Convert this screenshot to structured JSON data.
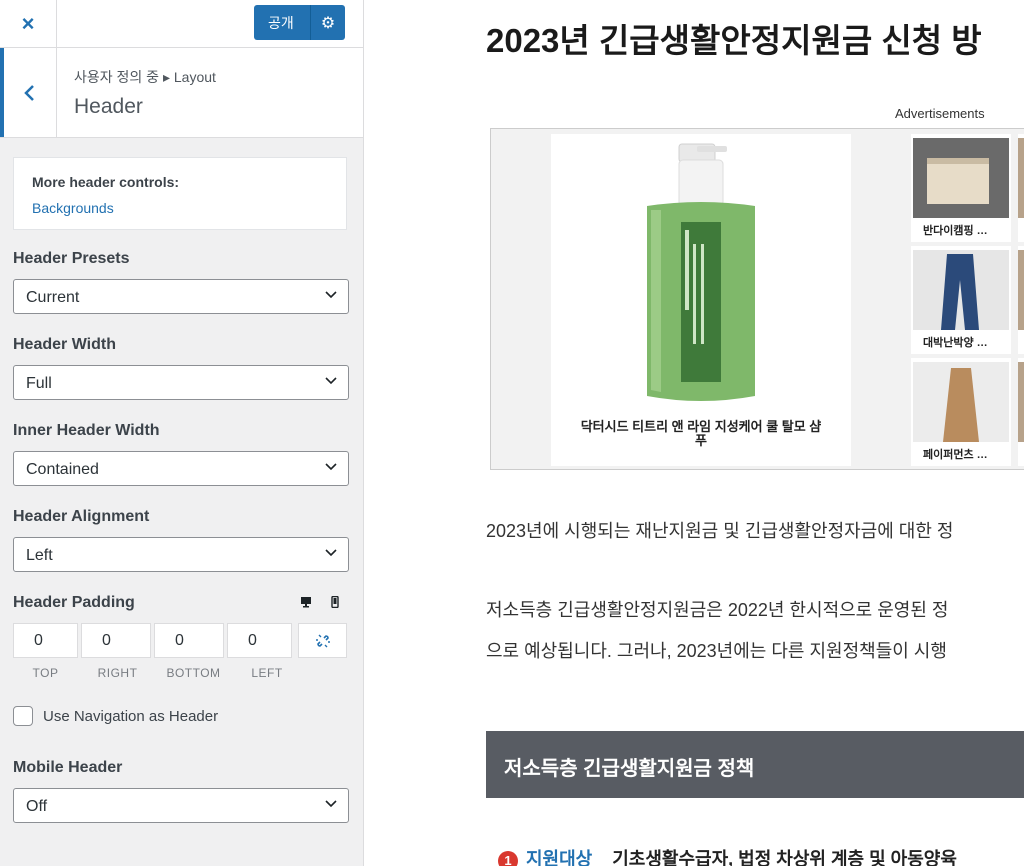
{
  "topbar": {
    "close_icon": "×",
    "publish_label": "공개",
    "gear_icon": "⚙"
  },
  "section": {
    "back_icon": "‹",
    "breadcrumb": "사용자 정의 중 ▸ Layout",
    "title": "Header"
  },
  "more_controls": {
    "title": "More header controls:",
    "link": "Backgrounds"
  },
  "controls": {
    "header_presets": {
      "label": "Header Presets",
      "value": "Current"
    },
    "header_width": {
      "label": "Header Width",
      "value": "Full"
    },
    "inner_header_width": {
      "label": "Inner Header Width",
      "value": "Contained"
    },
    "header_alignment": {
      "label": "Header Alignment",
      "value": "Left"
    },
    "header_padding": {
      "label": "Header Padding",
      "top": "0",
      "right": "0",
      "bottom": "0",
      "left": "0",
      "labels": [
        "TOP",
        "RIGHT",
        "BOTTOM",
        "LEFT"
      ]
    },
    "use_navigation": {
      "label": "Use Navigation as Header",
      "checked": false
    },
    "mobile_header": {
      "label": "Mobile Header",
      "value": "Off"
    }
  },
  "preview": {
    "title": "2023년 긴급생활안정지원금 신청 방",
    "ads_label": "Advertisements",
    "ad_main_caption_1": "닥터시드 티트리 앤 라임 지성케어 쿨 탈모 샴",
    "ad_main_caption_2": "푸",
    "thumbs": [
      "반다이캠핑 …",
      "대박난박양 …",
      "페이퍼먼츠 …"
    ],
    "para1": "2023년에 시행되는 재난지원금 및 긴급생활안정자금에 대한 정",
    "para2": "저소득층 긴급생활안정지원금은 2022년 한시적으로 운영된 정",
    "para3": "으로 예상됩니다. 그러나, 2023년에는 다른 지원정책들이 시행",
    "section_heading": "저소득층 긴급생활지원금 정책",
    "bottom_num": "1",
    "bottom_tag": "지원대상",
    "bottom_text": "기초생활수급자, 법정 차상위 계층 및 아동양육"
  },
  "colors": {
    "accent": "#2271b1",
    "section_bar": "#585c63"
  }
}
